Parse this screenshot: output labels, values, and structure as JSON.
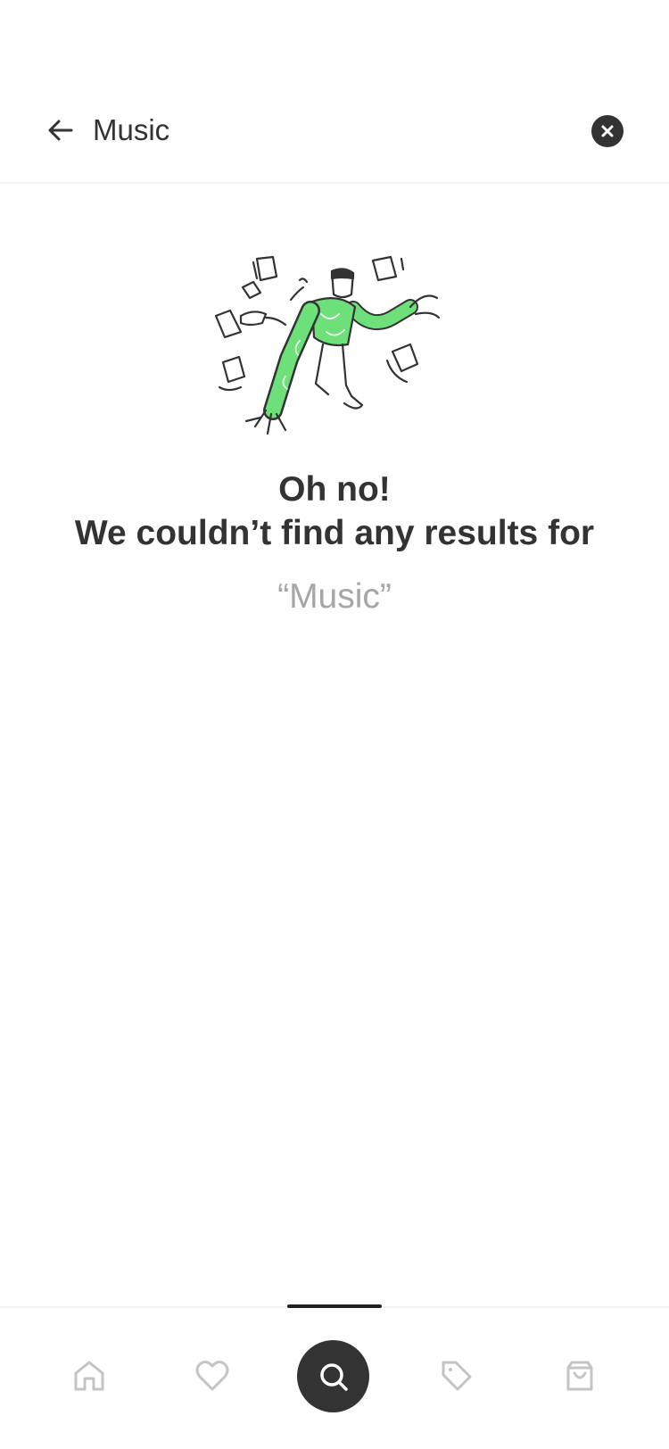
{
  "header": {
    "search_value": "Music",
    "back_icon": "arrow-left-icon",
    "clear_icon": "close-circle-icon"
  },
  "empty_state": {
    "illustration": "person-juggling-papers-illustration",
    "title_line1": "Oh no!",
    "title_line2": "We couldn’t find any results for",
    "query_text": "“Music”"
  },
  "tab_bar": {
    "tabs": [
      {
        "icon": "home-icon",
        "active": false
      },
      {
        "icon": "heart-icon",
        "active": false
      },
      {
        "icon": "search-icon",
        "active": true
      },
      {
        "icon": "tag-icon",
        "active": false
      },
      {
        "icon": "shopping-bag-icon",
        "active": false
      }
    ]
  },
  "colors": {
    "text": "#333333",
    "muted": "#a6a6a6",
    "accent_green": "#6ee07a",
    "icon_gray": "#c4c4c4",
    "active_tab_bg": "#333333"
  }
}
